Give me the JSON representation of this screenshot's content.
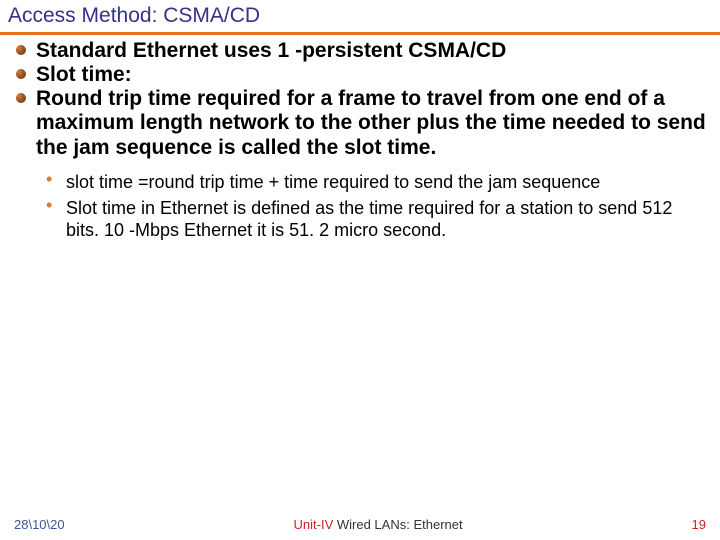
{
  "slide": {
    "title": "Access Method: CSMA/CD",
    "bullets": {
      "b1": "Standard Ethernet uses 1 -persistent CSMA/CD",
      "b2": "Slot time:",
      "b3": "Round trip time required for a frame to travel from one end of a maximum length network to the other plus the time needed to send the jam sequence is called the slot time."
    },
    "subbullets": {
      "s1": "slot time =round trip time + time required to send the jam sequence",
      "s2": "Slot time in Ethernet is defined as the time required for a station to send 512 bits. 10 -Mbps Ethernet it is 51. 2 micro second."
    }
  },
  "footer": {
    "date": "28\\10\\20",
    "unit_label": "Unit-IV",
    "topic": " Wired LANs: Ethernet",
    "page": "19"
  }
}
